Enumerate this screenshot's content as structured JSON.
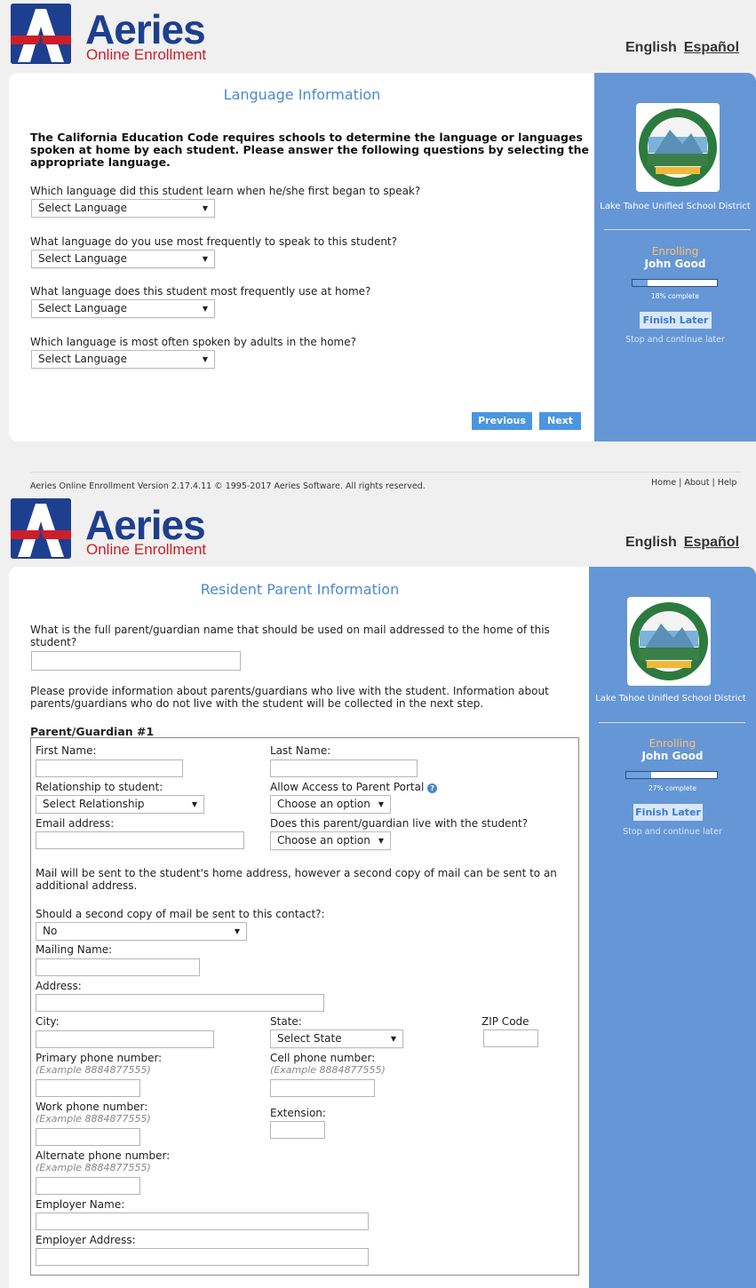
{
  "brand": {
    "name": "Aeries",
    "subtitle": "Online Enrollment"
  },
  "lang_links": {
    "english": "English",
    "spanish": "Español"
  },
  "language_page": {
    "title": "Language Information",
    "intro": "The California Education Code requires schools to determine the language or languages spoken at home by each student. Please answer the following questions by selecting the appropriate language.",
    "questions": [
      {
        "label": "Which language did this student learn when he/she first began to speak?",
        "value": "Select Language"
      },
      {
        "label": "What language do you use most frequently to speak to this student?",
        "value": "Select Language"
      },
      {
        "label": "What language does this student most frequently use at home?",
        "value": "Select Language"
      },
      {
        "label": "Which language is most often spoken by adults in the home?",
        "value": "Select Language"
      }
    ],
    "previous": "Previous",
    "next": "Next",
    "sidebar": {
      "district": "Lake Tahoe Unified School District",
      "enrolling": "Enrolling",
      "student": "John Good",
      "progress_text": "18% complete",
      "progress_value": 0.18,
      "finish_later": "Finish Later",
      "stop_text": "Stop and continue later"
    }
  },
  "footer": {
    "version": "Aeries Online Enrollment Version 2.17.4.11 © 1995-2017 Aeries Software. All rights reserved.",
    "home": "Home",
    "about": "About",
    "help": "Help",
    "sep": "|"
  },
  "parent_page": {
    "title": "Resident Parent Information",
    "mail_name_q": "What is the full parent/guardian name that should be used on mail addressed to the home of this student?",
    "mail_name_value": "",
    "info_text": "Please provide information about parents/guardians who live with the student. Information about parents/guardians who do not live with the student will be collected in the next step.",
    "guardian_heading": "Parent/Guardian #1",
    "first_name": "First Name:",
    "last_name": "Last Name:",
    "relationship": "Relationship to student:",
    "relationship_value": "Select Relationship",
    "portal": "Allow Access to Parent Portal",
    "portal_value": "Choose an option",
    "email": "Email address:",
    "lives_with": "Does this parent/guardian live with the student?",
    "lives_with_value": "Choose an option",
    "mail_note": "Mail will be sent to the student's home address, however a second copy of mail can be sent to an additional address.",
    "second_copy_q": "Should a second copy of mail be sent to this contact?:",
    "second_copy_value": "No",
    "mailing_name": "Mailing Name:",
    "address": "Address:",
    "city": "City:",
    "state": "State:",
    "state_value": "Select State",
    "zip": "ZIP Code",
    "primary_phone": "Primary phone number:",
    "cell_phone": "Cell phone number:",
    "work_phone": "Work phone number:",
    "extension": "Extension:",
    "alt_phone": "Alternate phone number:",
    "example": "(Example 8884877555)",
    "employer_name": "Employer Name:",
    "employer_address": "Employer Address:",
    "sidebar": {
      "district": "Lake Tahoe Unified School District",
      "enrolling": "Enrolling",
      "student": "John Good",
      "progress_text": "27% complete",
      "progress_value": 0.27,
      "finish_later": "Finish Later",
      "stop_text": "Stop and continue later"
    }
  },
  "colors": {
    "brand_blue": "#1e3f8f",
    "brand_red": "#cc1f28",
    "sidebar_blue": "#6596d6",
    "button_blue": "#4a96e0",
    "title_blue": "#4a8ad0",
    "enrolling_orange": "#ffc16a"
  },
  "icons": [
    "aeries-logo-icon",
    "school-seal-icon",
    "chevron-down-icon",
    "help-icon"
  ]
}
